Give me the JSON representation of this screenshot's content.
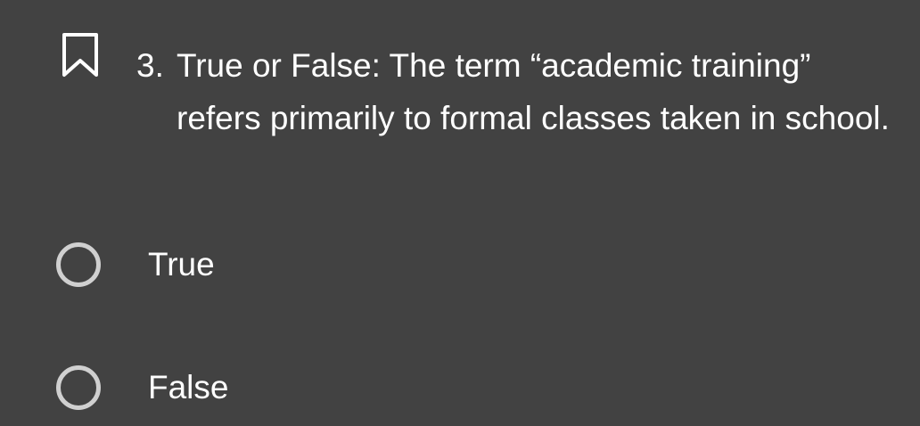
{
  "question": {
    "number": "3.",
    "text_line1": "True or False: The term “academic training”",
    "text_rest": "refers primarily to formal classes taken in school.",
    "bookmark_icon": "bookmark-outline-icon"
  },
  "options": [
    {
      "label": "True",
      "selected": false
    },
    {
      "label": "False",
      "selected": false
    }
  ],
  "colors": {
    "background": "#424242",
    "text": "#ffffff",
    "radio_ring": "#d0d0d0"
  }
}
